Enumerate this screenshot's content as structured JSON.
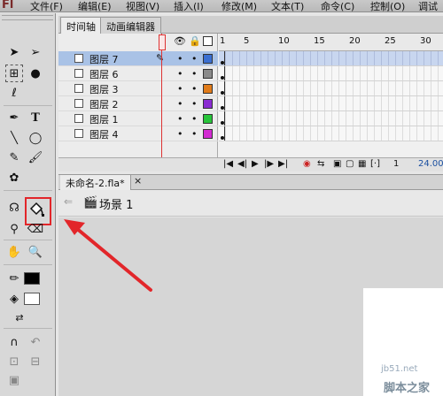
{
  "menubar": {
    "logo": "Fl",
    "items": [
      "文件(F)",
      "编辑(E)",
      "视图(V)",
      "插入(I)",
      "修改(M)",
      "文本(T)",
      "命令(C)",
      "控制(O)",
      "调试"
    ]
  },
  "timeline_tabs": [
    "时间轴",
    "动画编辑器"
  ],
  "ruler": [
    "1",
    "5",
    "10",
    "15",
    "20",
    "25",
    "30"
  ],
  "layers": [
    {
      "name": "图层 7",
      "color": "#3b6fd1",
      "selected": true
    },
    {
      "name": "图层 6",
      "color": "#8a8a8a",
      "selected": false
    },
    {
      "name": "图层 3",
      "color": "#e07b1a",
      "selected": false
    },
    {
      "name": "图层 2",
      "color": "#8a2bd1",
      "selected": false
    },
    {
      "name": "图层 1",
      "color": "#27c43a",
      "selected": false
    },
    {
      "name": "图层 4",
      "color": "#d22bd1",
      "selected": false
    }
  ],
  "layer_dots": "•",
  "timeline_bottom": {
    "fps": "24.00"
  },
  "doc_tab": {
    "name": "未命名-2.fla*",
    "close": "×"
  },
  "scene": {
    "label": "场景 1",
    "back": "⇐"
  },
  "watermark": {
    "site": "jb51.net",
    "name": "脚本之家"
  },
  "colors": {
    "highlight": "#e2262a",
    "arrow": "#e2262a",
    "stroke": "#000000",
    "fill": "#ffffff"
  }
}
